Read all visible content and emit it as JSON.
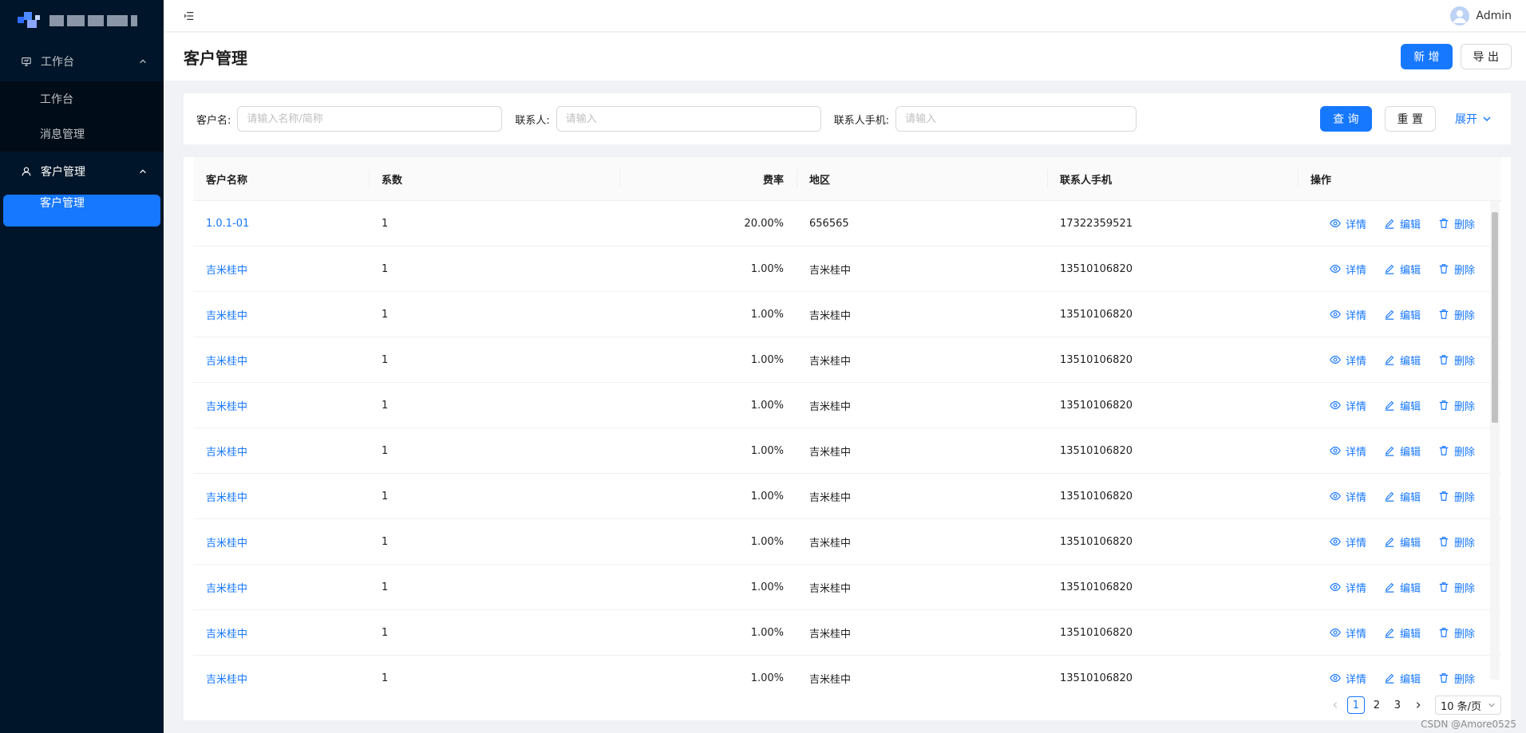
{
  "app": {
    "user_name": "Admin"
  },
  "sidebar": {
    "groups": [
      {
        "label": "工作台",
        "items": [
          {
            "label": "工作台"
          },
          {
            "label": "消息管理"
          }
        ]
      },
      {
        "label": "客户管理",
        "items": [
          {
            "label": "客户管理"
          }
        ]
      }
    ]
  },
  "page": {
    "title": "客户管理",
    "add_label": "新 增",
    "export_label": "导 出"
  },
  "search": {
    "customer_label": "客户名:",
    "customer_placeholder": "请输入名称/简称",
    "contact_label": "联系人:",
    "contact_placeholder": "请输入",
    "phone_label": "联系人手机:",
    "phone_placeholder": "请输入",
    "query_label": "查 询",
    "reset_label": "重 置",
    "expand_label": "展开"
  },
  "table": {
    "columns": [
      "客户名称",
      "系数",
      "费率",
      "地区",
      "联系人手机",
      "操作"
    ],
    "rows": [
      {
        "name": "1.0.1-01",
        "coef": "1",
        "rate": "20.00%",
        "region": "656565",
        "phone": "17322359521"
      },
      {
        "name": "吉米桂中",
        "coef": "1",
        "rate": "1.00%",
        "region": "吉米桂中",
        "phone": "13510106820"
      },
      {
        "name": "吉米桂中",
        "coef": "1",
        "rate": "1.00%",
        "region": "吉米桂中",
        "phone": "13510106820"
      },
      {
        "name": "吉米桂中",
        "coef": "1",
        "rate": "1.00%",
        "region": "吉米桂中",
        "phone": "13510106820"
      },
      {
        "name": "吉米桂中",
        "coef": "1",
        "rate": "1.00%",
        "region": "吉米桂中",
        "phone": "13510106820"
      },
      {
        "name": "吉米桂中",
        "coef": "1",
        "rate": "1.00%",
        "region": "吉米桂中",
        "phone": "13510106820"
      },
      {
        "name": "吉米桂中",
        "coef": "1",
        "rate": "1.00%",
        "region": "吉米桂中",
        "phone": "13510106820"
      },
      {
        "name": "吉米桂中",
        "coef": "1",
        "rate": "1.00%",
        "region": "吉米桂中",
        "phone": "13510106820"
      },
      {
        "name": "吉米桂中",
        "coef": "1",
        "rate": "1.00%",
        "region": "吉米桂中",
        "phone": "13510106820"
      },
      {
        "name": "吉米桂中",
        "coef": "1",
        "rate": "1.00%",
        "region": "吉米桂中",
        "phone": "13510106820"
      },
      {
        "name": "吉米桂中",
        "coef": "1",
        "rate": "1.00%",
        "region": "吉米桂中",
        "phone": "13510106820"
      }
    ],
    "actions": {
      "detail": "详情",
      "edit": "编辑",
      "delete": "删除"
    }
  },
  "pagination": {
    "pages": [
      "1",
      "2",
      "3"
    ],
    "current": "1",
    "page_size": "10 条/页"
  },
  "watermark": "CSDN @Amore0525",
  "colors": {
    "sidebar_bg": "#001529",
    "primary": "#1677ff"
  }
}
